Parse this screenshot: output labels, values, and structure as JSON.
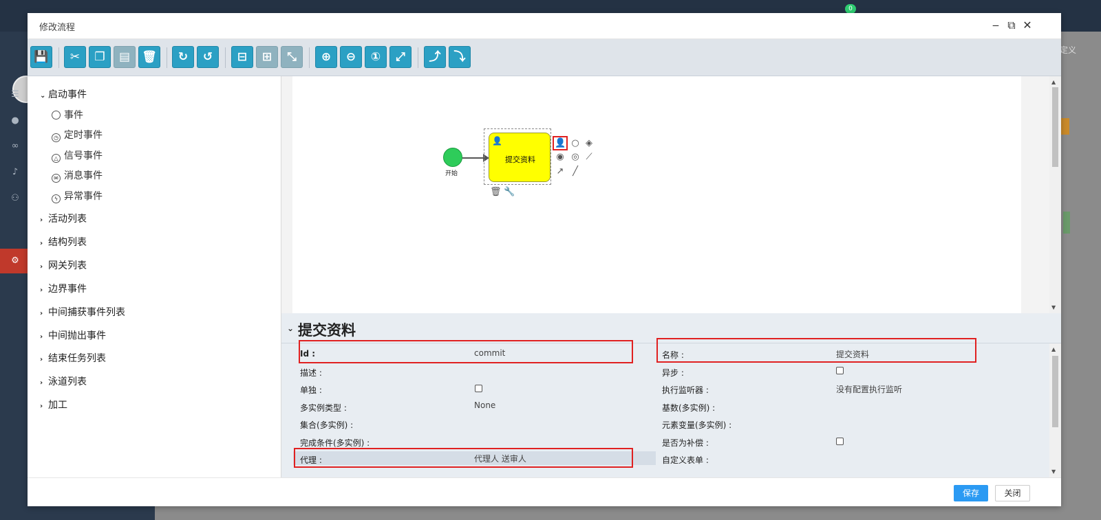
{
  "window": {
    "title": "修改流程"
  },
  "toolbar": {
    "buttons": [
      {
        "name": "save",
        "glyph": "💾"
      },
      {
        "name": "cut",
        "glyph": "✂"
      },
      {
        "name": "copy",
        "glyph": "❐"
      },
      {
        "name": "paste",
        "glyph": "▤"
      },
      {
        "name": "delete",
        "glyph": "🗑"
      },
      {
        "name": "redo",
        "glyph": "↻"
      },
      {
        "name": "undo",
        "glyph": "↺"
      },
      {
        "name": "align-horizontal",
        "glyph": "⊟"
      },
      {
        "name": "align-vertical",
        "glyph": "⊞"
      },
      {
        "name": "same-size",
        "glyph": "⤡"
      },
      {
        "name": "zoom-in",
        "glyph": "⊕"
      },
      {
        "name": "zoom-out",
        "glyph": "⊖"
      },
      {
        "name": "zoom-actual",
        "glyph": "①"
      },
      {
        "name": "zoom-fit",
        "glyph": "⤢"
      },
      {
        "name": "add-bendpoint",
        "glyph": "⤴"
      },
      {
        "name": "remove-bendpoint",
        "glyph": "⤵"
      }
    ]
  },
  "palette": {
    "expanded_group": "启动事件",
    "start_events": [
      "事件",
      "定时事件",
      "信号事件",
      "消息事件",
      "异常事件"
    ],
    "groups": [
      "活动列表",
      "结构列表",
      "网关列表",
      "边界事件",
      "中间捕获事件列表",
      "中间抛出事件",
      "结束任务列表",
      "泳道列表",
      "加工"
    ]
  },
  "diagram": {
    "start_label": "开始",
    "task_label": "提交资料"
  },
  "properties": {
    "title": "提交资料",
    "left": [
      {
        "label": "Id :",
        "value": "commit"
      },
      {
        "label": "描述 :",
        "value": ""
      },
      {
        "label": "单独 :",
        "value": "",
        "checkbox": true
      },
      {
        "label": "多实例类型 :",
        "value": "None"
      },
      {
        "label": "集合(多实例) :",
        "value": ""
      },
      {
        "label": "完成条件(多实例) :",
        "value": ""
      },
      {
        "label": "代理 :",
        "value": "代理人 送审人"
      }
    ],
    "right": [
      {
        "label": "名称 :",
        "value": "提交资料"
      },
      {
        "label": "异步 :",
        "value": "",
        "checkbox": true
      },
      {
        "label": "执行监听器 :",
        "value": "没有配置执行监听"
      },
      {
        "label": "基数(多实例) :",
        "value": ""
      },
      {
        "label": "元素变量(多实例) :",
        "value": ""
      },
      {
        "label": "是否为补偿 :",
        "value": "",
        "checkbox": true
      },
      {
        "label": "自定义表单 :",
        "value": ""
      }
    ]
  },
  "footer": {
    "save": "保存",
    "close": "关闭"
  },
  "background": {
    "badge": "0",
    "right_text": "定义"
  },
  "colors": {
    "accent": "#2ba0c4",
    "task_fill": "#ffff00",
    "start_fill": "#2ecc5a",
    "highlight": "#e02020",
    "save_btn": "#2b9af3"
  }
}
